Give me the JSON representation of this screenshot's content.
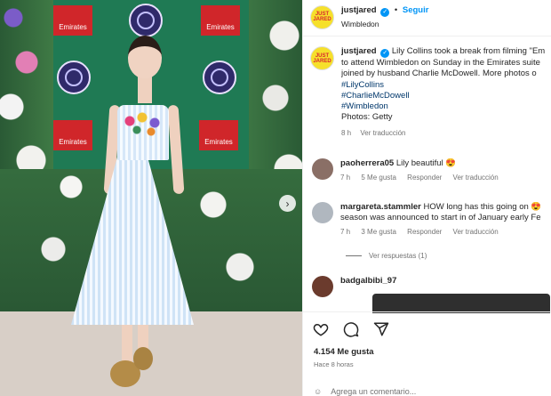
{
  "post": {
    "username": "justjared",
    "follow_label": "Seguir",
    "location": "Wimbledon",
    "avatar_text": "JUST JARED",
    "caption_lines": [
      "Lily Collins took a break from filming \"Em",
      "to attend Wimbledon on Sunday in the Emirates suite",
      "joined by husband Charlie McDowell. More photos o"
    ],
    "hashtags": [
      "#LilyCollins",
      "#CharlieMcDowell",
      "#Wimbledon"
    ],
    "credit": "Photos: Getty",
    "caption_time": "8 h",
    "see_translation": "Ver traducción"
  },
  "comments": [
    {
      "username": "paoherrera05",
      "text": "Lily beautiful",
      "emoji": "😍",
      "time": "7 h",
      "likes": "5 Me gusta",
      "reply": "Responder",
      "translate": "Ver traducción"
    },
    {
      "username": "margareta.stammler",
      "text": "HOW long has this going on",
      "emoji": "😍",
      "text2": "season was announced to start in of January early Fe",
      "time": "7 h",
      "likes": "3 Me gusta",
      "reply": "Responder",
      "translate": "Ver traducción"
    },
    {
      "username": "badgalbibi_97",
      "text": ""
    }
  ],
  "view_replies": "Ver respuestas (1)",
  "likes_count": "4.154 Me gusta",
  "time_ago": "Hace 8 horas",
  "add_comment_placeholder": "Agrega un comentario...",
  "colors": {
    "accent_blue": "#0095f6",
    "hashtag": "#00376b",
    "muted": "#737373",
    "brand_yellow": "#f6e02b"
  },
  "icons": [
    "verified-badge-icon",
    "heart-icon",
    "comment-icon",
    "share-icon",
    "chevron-right-icon",
    "emoji-icon"
  ]
}
